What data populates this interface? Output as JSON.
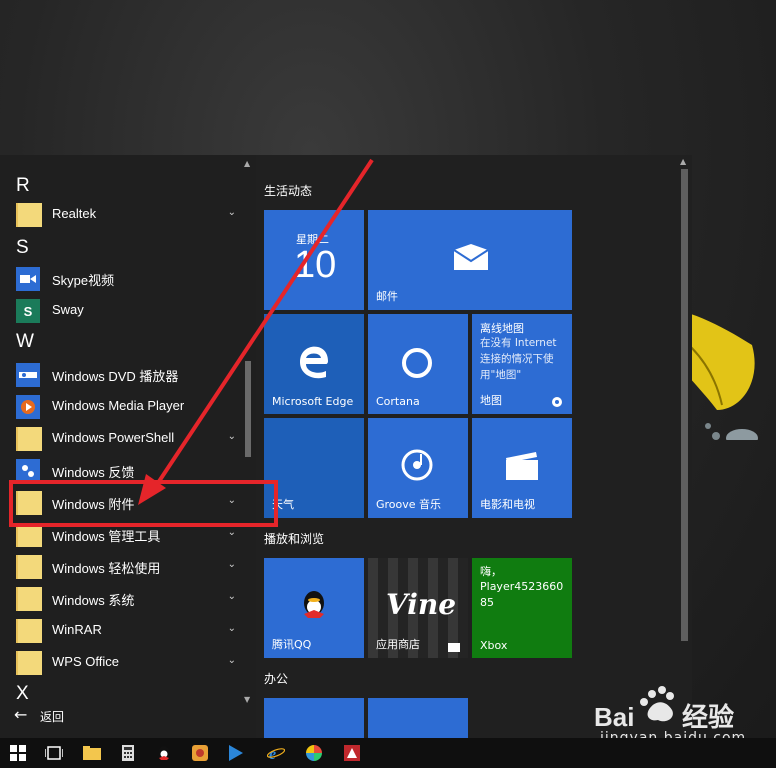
{
  "app_list": {
    "letters": [
      "R",
      "S",
      "W",
      "X"
    ],
    "items": [
      {
        "label": "Realtek",
        "icon": "folder-icon",
        "expandable": true
      },
      {
        "label": "Skype视频",
        "icon": "skype-video-icon",
        "expandable": false
      },
      {
        "label": "Sway",
        "icon": "sway-icon",
        "expandable": false
      },
      {
        "label": "Windows DVD 播放器",
        "icon": "dvd-player-icon",
        "expandable": false
      },
      {
        "label": "Windows Media Player",
        "icon": "media-player-icon",
        "expandable": false
      },
      {
        "label": "Windows PowerShell",
        "icon": "folder-icon",
        "expandable": true
      },
      {
        "label": "Windows 反馈",
        "icon": "feedback-icon",
        "expandable": false
      },
      {
        "label": "Windows 附件",
        "icon": "folder-icon",
        "expandable": true
      },
      {
        "label": "Windows 管理工具",
        "icon": "folder-icon",
        "expandable": true
      },
      {
        "label": "Windows 轻松使用",
        "icon": "folder-icon",
        "expandable": true
      },
      {
        "label": "Windows 系统",
        "icon": "folder-icon",
        "expandable": true
      },
      {
        "label": "WinRAR",
        "icon": "folder-icon",
        "expandable": true
      },
      {
        "label": "WPS Office",
        "icon": "folder-icon",
        "expandable": true
      }
    ],
    "back_label": "返回"
  },
  "groups": {
    "life": "生活动态",
    "play": "播放和浏览",
    "office": "办公"
  },
  "tiles": {
    "calendar_day": "星期二",
    "calendar_date": "10",
    "mail": "邮件",
    "edge": "Microsoft Edge",
    "cortana": "Cortana",
    "maps_title": "离线地图",
    "maps_body": "在没有 Internet 连接的情况下使用\"地图\"",
    "maps_label": "地图",
    "weather": "天气",
    "groove": "Groove 音乐",
    "movies": "电影和电视",
    "qq": "腾讯QQ",
    "store": "应用商店",
    "store_art": "Vine",
    "xbox_greeting": "嗨，",
    "xbox_user": "Player452366085",
    "xbox_label": "Xbox"
  },
  "colors": {
    "tile_blue": "#2d6cd3",
    "tile_dark_blue": "#1e5fb8",
    "xbox_green": "#107c10",
    "highlight_red": "#e5252a",
    "folder_yellow": "#f3d97b"
  },
  "watermark": {
    "brand": "Baidu经验",
    "url": "jingyan.baidu.com"
  }
}
